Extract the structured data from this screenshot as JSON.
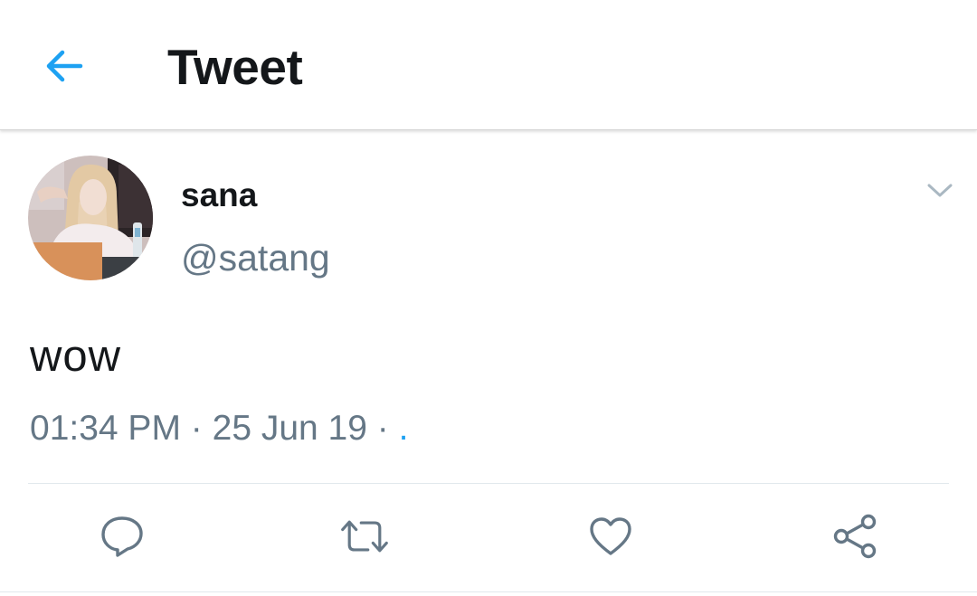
{
  "header": {
    "title": "Tweet",
    "back_icon": "arrow-left-icon",
    "accent_color": "#1da1f2"
  },
  "tweet": {
    "author": {
      "display_name": "sana",
      "handle": "@satang"
    },
    "text": "wow",
    "time": "01:34 PM",
    "date": "25 Jun 19",
    "separator": "·",
    "source": "."
  },
  "actions": [
    {
      "icon": "reply-icon"
    },
    {
      "icon": "retweet-icon"
    },
    {
      "icon": "like-icon"
    },
    {
      "icon": "share-icon"
    }
  ],
  "colors": {
    "text_primary": "#14171a",
    "text_secondary": "#657786",
    "icon_gray": "#657786",
    "link_blue": "#1da1f2",
    "divider": "#e1e8ed"
  }
}
